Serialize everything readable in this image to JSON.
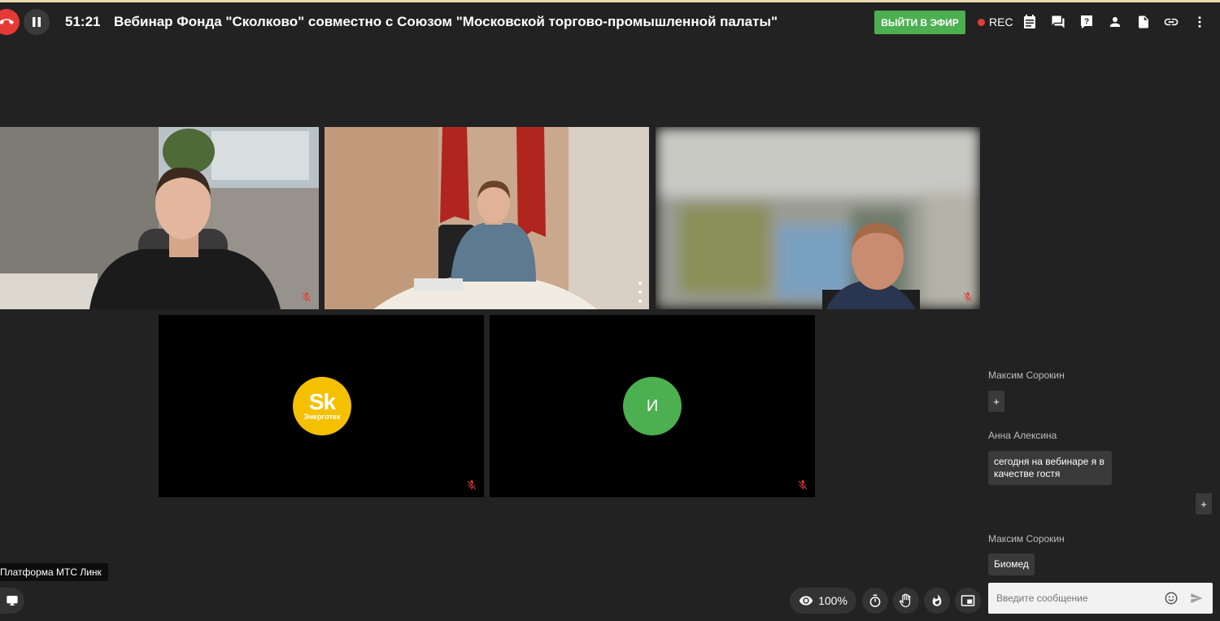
{
  "header": {
    "timer": "51:21",
    "title": "Вебинар Фонда \"Сколково\" совместно с Союзом \"Московской торгово-промышленной палаты\"",
    "live_button": "ВЫЙТИ В ЭФИР",
    "rec_label": "REC",
    "icons": [
      "hangup-icon",
      "pause-icon",
      "notes-icon",
      "chat-icon",
      "question-icon",
      "participants-icon",
      "document-icon",
      "link-icon",
      "more-vert-icon"
    ]
  },
  "tiles": [
    {
      "id": "p1",
      "type": "video",
      "muted": true
    },
    {
      "id": "p2",
      "type": "video",
      "muted": false,
      "active": true
    },
    {
      "id": "p3",
      "type": "video",
      "muted": true
    },
    {
      "id": "p4",
      "type": "avatar",
      "logo_main": "Sk",
      "logo_sub": "Энерготех",
      "avatar_color": "#f5c000",
      "muted": true
    },
    {
      "id": "p5",
      "type": "avatar",
      "initial": "И",
      "avatar_color": "#4caf50",
      "muted": true
    }
  ],
  "chat": {
    "messages": [
      {
        "author": "Максим Сорокин",
        "text": "+"
      },
      {
        "author": "Анна Алексина",
        "text": "сегодня на вебинаре я в качестве гостя"
      },
      {
        "author": "",
        "text": "+"
      },
      {
        "author": "Максим Сорокин",
        "text": "Биомед"
      }
    ],
    "input_placeholder": "Введите сообщение"
  },
  "bottom": {
    "tooltip": "Платформа МТС Линк",
    "view_percent": "100%"
  },
  "colors": {
    "background": "#222222",
    "accent_green": "#4caf50",
    "hangup_red": "#e53935",
    "muted_red": "#e53935"
  }
}
